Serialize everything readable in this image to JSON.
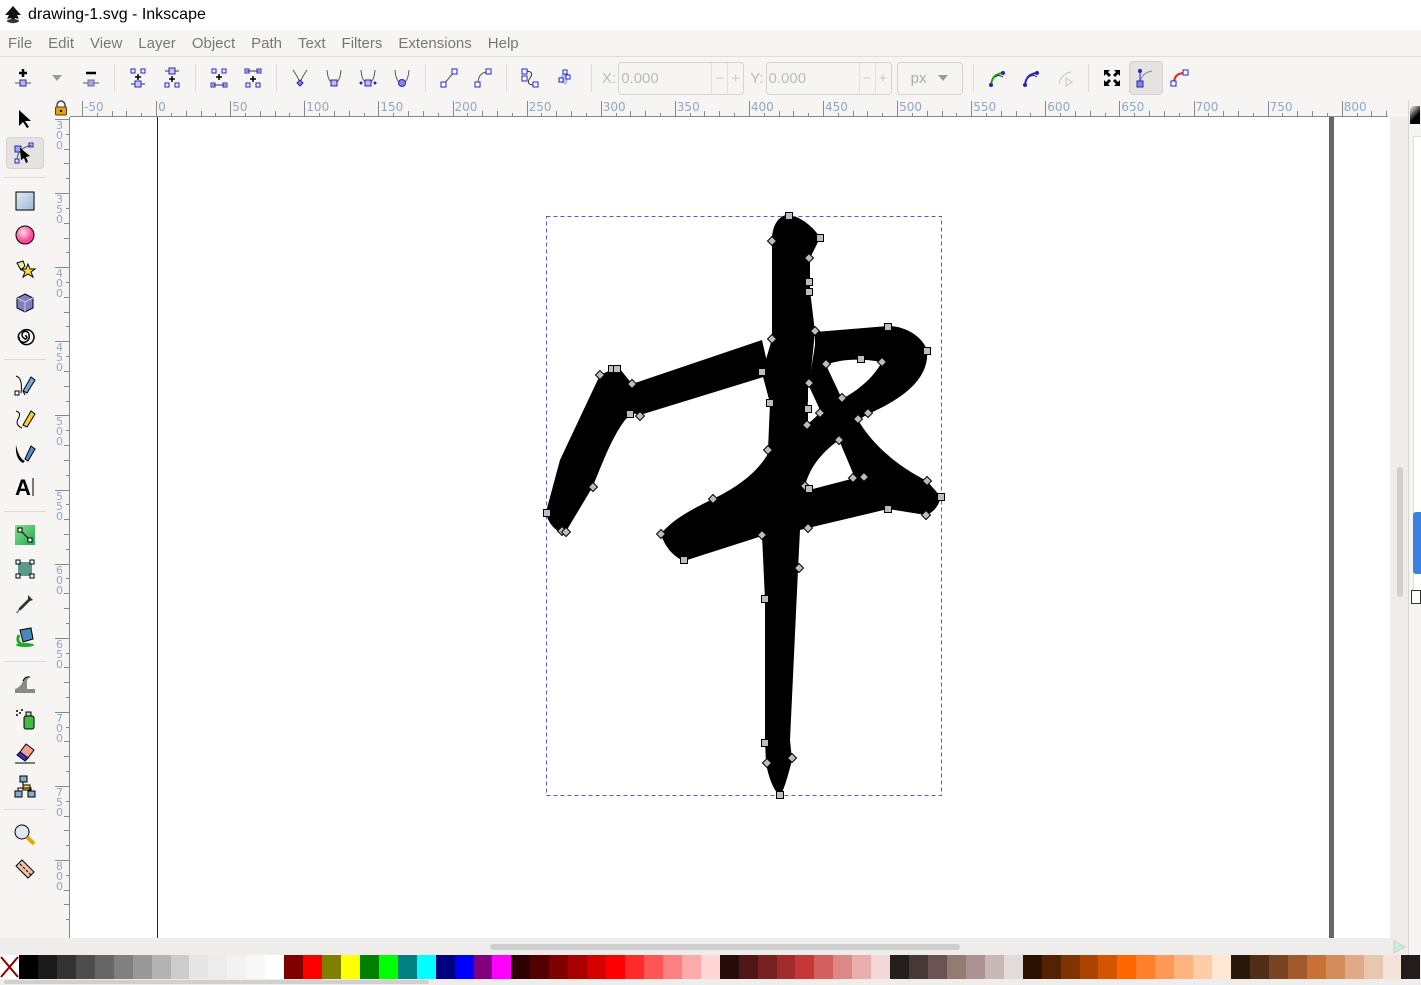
{
  "window": {
    "title": "drawing-1.svg - Inkscape",
    "icon": "inkscape-logo-icon"
  },
  "menubar": {
    "items": [
      "File",
      "Edit",
      "View",
      "Layer",
      "Object",
      "Path",
      "Text",
      "Filters",
      "Extensions",
      "Help"
    ]
  },
  "toolbar": {
    "node_buttons": [
      {
        "name": "insert-node-icon"
      },
      {
        "name": "insert-node-dropdown-icon"
      },
      {
        "name": "delete-node-icon"
      },
      {
        "name": "join-nodes-icon"
      },
      {
        "name": "break-path-icon"
      },
      {
        "name": "join-segment-icon"
      },
      {
        "name": "delete-segment-icon"
      },
      {
        "name": "node-cusp-icon"
      },
      {
        "name": "node-smooth-icon"
      },
      {
        "name": "node-symmetric-icon"
      },
      {
        "name": "node-auto-icon"
      },
      {
        "name": "segment-line-icon"
      },
      {
        "name": "segment-curve-icon"
      },
      {
        "name": "object-to-path-icon"
      },
      {
        "name": "stroke-to-path-icon"
      }
    ],
    "x_label": "X:",
    "x_value": "0.000",
    "y_label": "Y:",
    "y_value": "0.000",
    "minus": "−",
    "plus": "+",
    "unit": "px",
    "right_buttons": [
      {
        "name": "edit-clip-path-icon"
      },
      {
        "name": "edit-mask-icon"
      },
      {
        "name": "path-effect-icon"
      },
      {
        "name": "transform-handles-icon"
      },
      {
        "name": "show-handles-icon",
        "active": true
      },
      {
        "name": "show-path-outline-icon"
      }
    ]
  },
  "tools": [
    {
      "name": "selector-tool",
      "active": false
    },
    {
      "name": "node-tool",
      "active": true
    },
    {
      "name": "rectangle-tool"
    },
    {
      "name": "ellipse-tool"
    },
    {
      "name": "star-tool"
    },
    {
      "name": "3d-box-tool"
    },
    {
      "name": "spiral-tool"
    },
    {
      "name": "bezier-pen-tool"
    },
    {
      "name": "pencil-tool"
    },
    {
      "name": "calligraphy-tool"
    },
    {
      "name": "text-tool"
    },
    {
      "name": "gradient-tool"
    },
    {
      "name": "mesh-tool"
    },
    {
      "name": "dropper-tool"
    },
    {
      "name": "paint-bucket-tool"
    },
    {
      "name": "tweak-tool"
    },
    {
      "name": "spray-tool"
    },
    {
      "name": "eraser-tool"
    },
    {
      "name": "connector-tool"
    },
    {
      "name": "zoom-tool"
    },
    {
      "name": "measure-tool"
    }
  ],
  "rulers": {
    "horizontal": [
      "-50",
      "0",
      "50",
      "100",
      "150",
      "200",
      "250",
      "300",
      "350",
      "400",
      "450",
      "500",
      "550",
      "600",
      "650",
      "700",
      "750",
      "800"
    ],
    "vertical": [
      "300",
      "350",
      "400",
      "450",
      "500",
      "550",
      "600",
      "650",
      "700",
      "750",
      "800"
    ]
  },
  "canvas": {
    "glyph": "中",
    "fill": "#000000",
    "bbox_color": "#5a5ad0"
  },
  "palette": {
    "none_label": "X",
    "colors": [
      "#000000",
      "#1a1a1a",
      "#333333",
      "#4d4d4d",
      "#666666",
      "#808080",
      "#999999",
      "#b3b3b3",
      "#cccccc",
      "#e6e6e6",
      "#ececec",
      "#f2f2f2",
      "#f8f8f8",
      "#ffffff",
      "#800000",
      "#ff0000",
      "#808000",
      "#ffff00",
      "#008000",
      "#00ff00",
      "#008080",
      "#00ffff",
      "#000080",
      "#0000ff",
      "#800080",
      "#ff00ff",
      "#2b0000",
      "#550000",
      "#800000",
      "#aa0000",
      "#d40000",
      "#ff0000",
      "#ff2a2a",
      "#ff5555",
      "#ff8080",
      "#ffaaaa",
      "#ffd5d5",
      "#280b0b",
      "#501616",
      "#782121",
      "#a02c2c",
      "#c83737",
      "#d35f5f",
      "#de8787",
      "#e9afaf",
      "#f4d7d7",
      "#241f1c",
      "#483737",
      "#6c5353",
      "#917c6f",
      "#ac9393",
      "#c8b7b7",
      "#e3dbdb",
      "#2b1100",
      "#552200",
      "#803300",
      "#aa4400",
      "#d45500",
      "#ff6600",
      "#ff7f2a",
      "#ff9955",
      "#ffb380",
      "#ffccaa",
      "#ffe6d5",
      "#28170b",
      "#502d16",
      "#784421",
      "#a05a2c",
      "#c87137",
      "#d38d5f",
      "#deaa87",
      "#e9c6af",
      "#f4e3d7",
      "#241c1c"
    ]
  }
}
